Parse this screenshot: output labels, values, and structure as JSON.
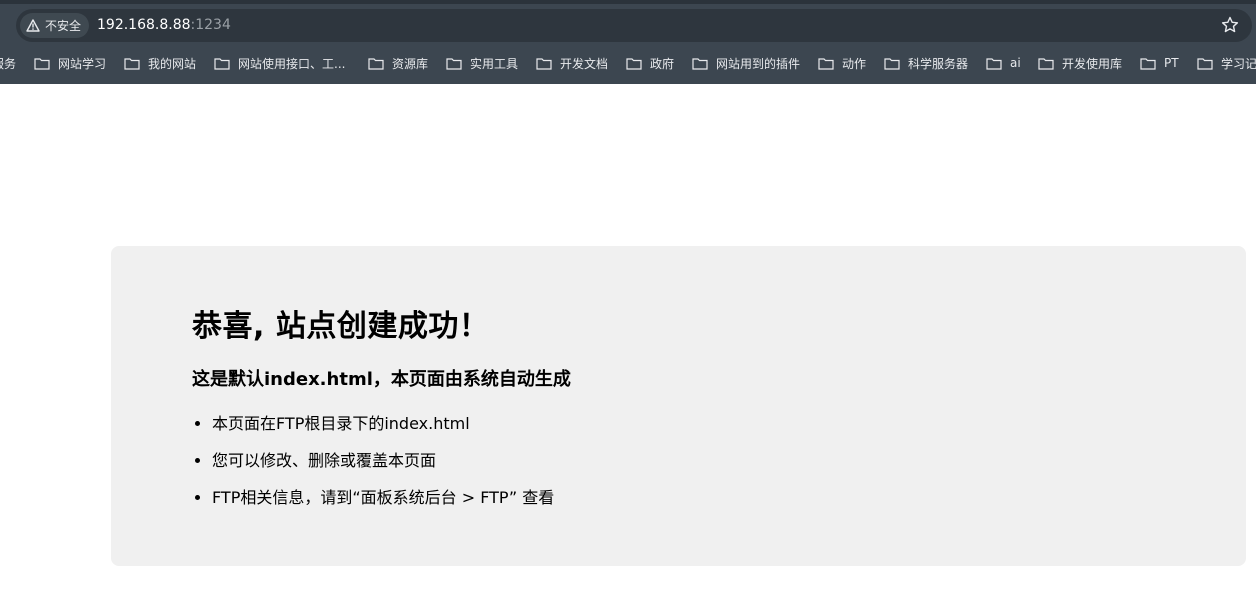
{
  "browser": {
    "security_label": "不安全",
    "url_host": "192.168.8.88",
    "url_port": ":1234",
    "bookmarks": [
      "服务",
      "网站学习",
      "我的网站",
      "网站使用接口、工...",
      "资源库",
      "实用工具",
      "开发文档",
      "政府",
      "网站用到的插件",
      "动作",
      "科学服务器",
      "ai",
      "开发使用库",
      "PT",
      "学习记"
    ]
  },
  "page": {
    "title": "恭喜, 站点创建成功！",
    "subtitle": "这是默认index.html，本页面由系统自动生成",
    "items": [
      "本页面在FTP根目录下的index.html",
      "您可以修改、删除或覆盖本页面",
      "FTP相关信息，请到“面板系统后台 > FTP” 查看"
    ]
  },
  "colors": {
    "toolbar_bg": "#3c4650",
    "omnibox_bg": "#2e363e",
    "card_bg": "#f0f0f0"
  }
}
